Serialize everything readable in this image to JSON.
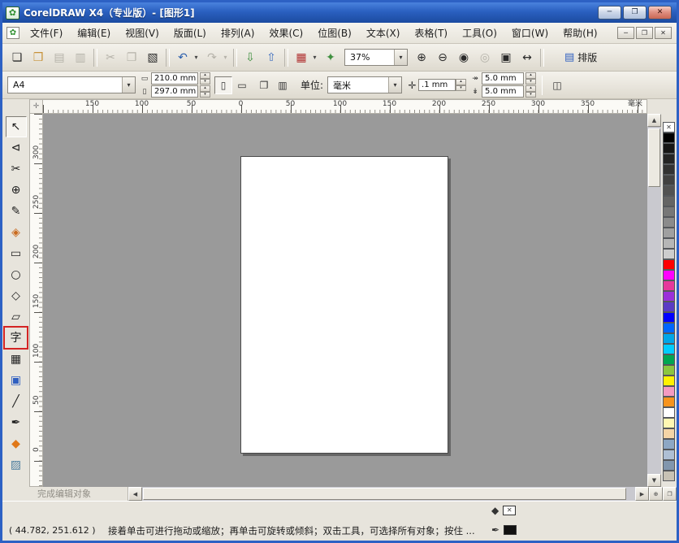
{
  "titlebar": {
    "title": "CorelDRAW X4（专业版）- [图形1]"
  },
  "icons": {
    "app": "✿",
    "document": "✿",
    "minimize": "─",
    "maximize": "❐",
    "close": "✕",
    "mdi_minimize": "─",
    "mdi_restore": "❐",
    "mdi_close": "✕",
    "combo_arrow": "▾",
    "spin_up": "▴",
    "spin_down": "▾",
    "paper_width": "▭",
    "paper_height": "▯",
    "portrait": "▯",
    "landscape": "▭",
    "pages_all": "❐",
    "pages_current": "▥",
    "nudge": "✛",
    "duplicate_x": "↠",
    "duplicate_y": "↡",
    "extra": "◫",
    "layout": "▤",
    "ruler_origin": "✛",
    "scroll_up": "▲",
    "scroll_down": "▼",
    "scroll_left": "◀",
    "scroll_right": "▶",
    "bottom_zoom": "⊕",
    "bottom_navigator": "❐",
    "none_swatch": "✕",
    "status_fill": "◆",
    "status_outline": "✒"
  },
  "menubar": {
    "items": [
      {
        "name": "menu-file",
        "label": "文件(F)"
      },
      {
        "name": "menu-edit",
        "label": "编辑(E)"
      },
      {
        "name": "menu-view",
        "label": "视图(V)"
      },
      {
        "name": "menu-layout",
        "label": "版面(L)"
      },
      {
        "name": "menu-arrange",
        "label": "排列(A)"
      },
      {
        "name": "menu-effects",
        "label": "效果(C)"
      },
      {
        "name": "menu-bitmaps",
        "label": "位图(B)"
      },
      {
        "name": "menu-text",
        "label": "文本(X)"
      },
      {
        "name": "menu-table",
        "label": "表格(T)"
      },
      {
        "name": "menu-tools",
        "label": "工具(O)"
      },
      {
        "name": "menu-window",
        "label": "窗口(W)"
      },
      {
        "name": "menu-help",
        "label": "帮助(H)"
      }
    ]
  },
  "toolbar": {
    "items": [
      {
        "name": "new-document-icon",
        "glyph": "❏"
      },
      {
        "name": "open-folder-icon",
        "glyph": "❒",
        "color": "#c79238"
      },
      {
        "name": "save-icon",
        "glyph": "▤",
        "disabled": true
      },
      {
        "name": "print-icon",
        "glyph": "▥",
        "disabled": true
      },
      {
        "name": "toolbar-separator",
        "sep": true,
        "interactable": false
      },
      {
        "name": "cut-icon",
        "glyph": "✂",
        "disabled": true
      },
      {
        "name": "copy-icon",
        "glyph": "❐",
        "disabled": true
      },
      {
        "name": "paste-icon",
        "glyph": "▧"
      },
      {
        "name": "toolbar-separator",
        "sep": true,
        "interactable": false
      },
      {
        "name": "undo-icon",
        "glyph": "↶",
        "color": "#2b5fad"
      },
      {
        "name": "undo-dropdown-icon",
        "glyph": "▾",
        "narrow": true
      },
      {
        "name": "redo-icon",
        "glyph": "↷",
        "disabled": true
      },
      {
        "name": "redo-dropdown-icon",
        "glyph": "▾",
        "narrow": true,
        "disabled": true
      },
      {
        "name": "toolbar-separator",
        "sep": true,
        "interactable": false
      },
      {
        "name": "import-icon",
        "glyph": "⇩",
        "color": "#3f8f3f"
      },
      {
        "name": "export-icon",
        "glyph": "⇧",
        "color": "#3f6fbf"
      },
      {
        "name": "toolbar-separator",
        "sep": true,
        "interactable": false
      },
      {
        "name": "application-launcher-icon",
        "glyph": "▦",
        "color": "#b03030"
      },
      {
        "name": "launcher-dropdown-icon",
        "glyph": "▾",
        "narrow": true
      },
      {
        "name": "welcome-screen-icon",
        "glyph": "✦",
        "color": "#3f8f3f"
      }
    ],
    "zoom_value": "37%",
    "zoom_icons": [
      {
        "name": "zoom-in-icon",
        "glyph": "⊕"
      },
      {
        "name": "zoom-out-icon",
        "glyph": "⊖"
      },
      {
        "name": "zoom-one-shot-icon",
        "glyph": "◉"
      },
      {
        "name": "zoom-to-selection-icon",
        "glyph": "◎",
        "disabled": true
      },
      {
        "name": "zoom-to-all-icon",
        "glyph": "▣"
      },
      {
        "name": "zoom-to-page-icon",
        "glyph": "↔"
      }
    ],
    "layout_label": "排版"
  },
  "property_bar": {
    "paper_size": "A4",
    "paper_width": "210.0 mm",
    "paper_height": "297.0 mm",
    "units_label": "单位:",
    "units_value": "毫米",
    "nudge_offset": ".1 mm",
    "duplicate_x": "5.0 mm",
    "duplicate_y": "5.0 mm"
  },
  "rulers": {
    "h_labels": [
      "150",
      "100",
      "50",
      "0",
      "50",
      "100",
      "150",
      "200",
      "250",
      "300",
      "350"
    ],
    "unit": "毫米",
    "v_labels": [
      "300",
      "250",
      "200",
      "150",
      "100",
      "50",
      "0"
    ]
  },
  "toolbox": {
    "tools": [
      {
        "name": "pick-tool",
        "glyph": "↖",
        "selected": true
      },
      {
        "name": "shape-tool",
        "glyph": "⊲"
      },
      {
        "name": "crop-tool",
        "glyph": "✂"
      },
      {
        "name": "zoom-tool",
        "glyph": "⊕"
      },
      {
        "name": "freehand-tool",
        "glyph": "✎"
      },
      {
        "name": "smart-fill-tool",
        "glyph": "◈",
        "color": "#c96a1e"
      },
      {
        "name": "rectangle-tool",
        "glyph": "▭"
      },
      {
        "name": "ellipse-tool",
        "glyph": "○"
      },
      {
        "name": "polygon-tool",
        "glyph": "◇"
      },
      {
        "name": "basic-shapes-tool",
        "glyph": "▱"
      },
      {
        "name": "text-tool",
        "glyph": "字"
      },
      {
        "name": "table-tool",
        "glyph": "▦"
      },
      {
        "name": "interactive-blend-tool",
        "glyph": "▣",
        "color": "#2f5fc0"
      },
      {
        "name": "eyedropper-tool",
        "glyph": "╱"
      },
      {
        "name": "outline-tool",
        "glyph": "✒"
      },
      {
        "name": "fill-tool",
        "glyph": "◆",
        "color": "#e07818"
      },
      {
        "name": "interactive-fill-tool",
        "glyph": "▨",
        "color": "#4f7f9f"
      }
    ]
  },
  "palette": {
    "colors": [
      "#000000",
      "#161616",
      "#242424",
      "#323232",
      "#414141",
      "#525252",
      "#646464",
      "#777777",
      "#8b8b8b",
      "#a0a0a0",
      "#b6b6b6",
      "#cdcdcd",
      "#ff0000",
      "#ff00ff",
      "#e6399b",
      "#9b30d9",
      "#5b3cc4",
      "#0000ff",
      "#0066ff",
      "#00a6e8",
      "#00ccff",
      "#00a651",
      "#8cc63f",
      "#fff200",
      "#f49ac1",
      "#f7941d",
      "#ffffff",
      "#fff7b2",
      "#f5d5a6",
      "#8da7c4",
      "#aebfd4",
      "#8196ad",
      "#c8c2b4"
    ]
  },
  "status": {
    "last_action": "完成编辑对象",
    "coordinates": "( 44.782, 251.612 )",
    "hint": "接着单击可进行拖动或缩放；再单击可旋转或倾斜；双击工具，可选择所有对象；按住 ..."
  }
}
